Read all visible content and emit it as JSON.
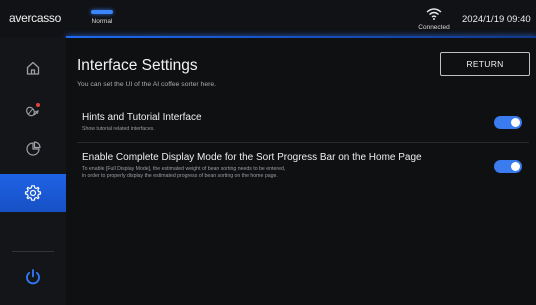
{
  "header": {
    "brand": "avercasso",
    "mode_label": "Normal",
    "connection_label": "Connected",
    "datetime": "2024/1/19 09:40"
  },
  "sidebar": {
    "items": [
      {
        "icon": "home-icon"
      },
      {
        "icon": "coffee-bean-alert-icon"
      },
      {
        "icon": "pie-chart-icon"
      },
      {
        "icon": "gear-icon",
        "active": true
      },
      {
        "icon": "power-icon"
      }
    ]
  },
  "main": {
    "title": "Interface Settings",
    "subtitle": "You can set the UI of the AI coffee sorter here.",
    "return_label": "RETURN",
    "settings": [
      {
        "title": "Hints and Tutorial Interface",
        "description": "Show tutorial related interfaces.",
        "enabled": true
      },
      {
        "title": "Enable Complete Display Mode for the Sort Progress Bar on the Home Page",
        "description_line1": "To enable [Full Display Mode], the estimated weight of bean sorting needs to be entered,",
        "description_line2": "in order to properly display the estimated progress of bean sorting on the home page.",
        "enabled": true
      }
    ]
  },
  "colors": {
    "accent": "#1f63e6",
    "toggle_on": "#3a7bf0",
    "background": "#0f1012"
  }
}
